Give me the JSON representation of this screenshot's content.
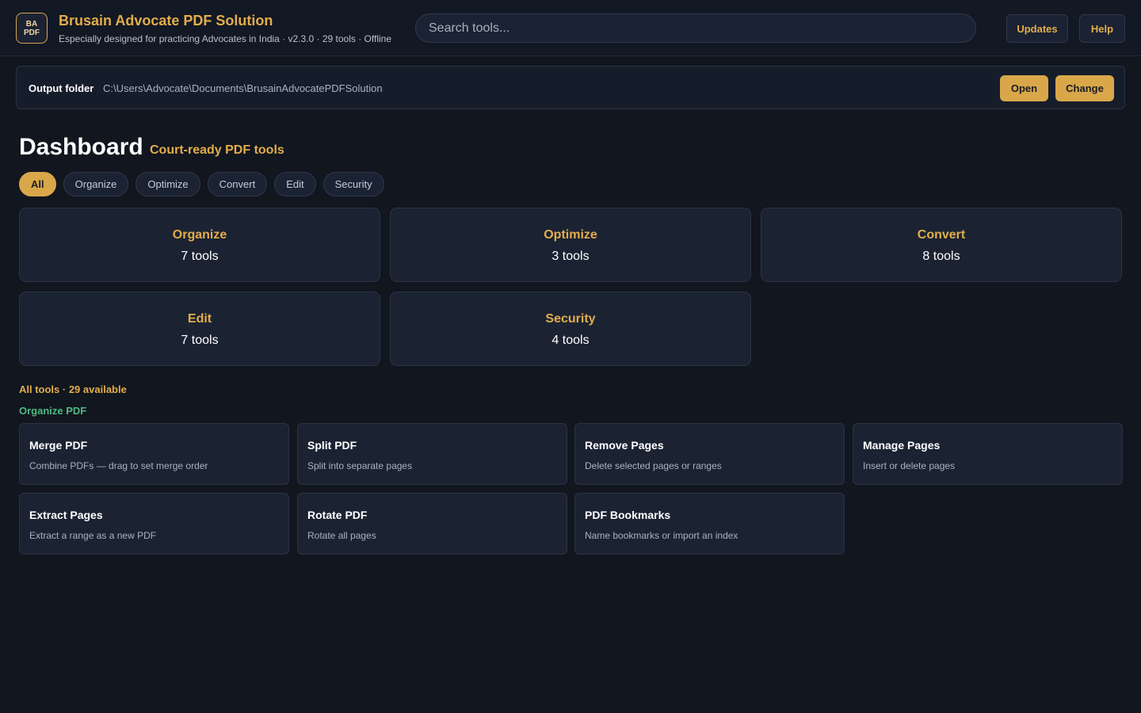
{
  "header": {
    "logo_line1": "BA",
    "logo_line2": "PDF",
    "title": "Brusain Advocate PDF Solution",
    "subtitle": "Especially designed for practicing Advocates in India · v2.3.0 · 29 tools · Offline",
    "search_placeholder": "Search tools...",
    "updates_label": "Updates",
    "help_label": "Help"
  },
  "output": {
    "label": "Output folder",
    "path": "C:\\Users\\Advocate\\Documents\\BrusainAdvocatePDFSolution",
    "open_label": "Open",
    "change_label": "Change"
  },
  "dashboard": {
    "title": "Dashboard",
    "subtitle": "Court-ready PDF tools",
    "filters": [
      "All",
      "Organize",
      "Optimize",
      "Convert",
      "Edit",
      "Security"
    ],
    "active_filter": "All"
  },
  "categories": [
    {
      "name": "Organize",
      "count": "7 tools"
    },
    {
      "name": "Optimize",
      "count": "3 tools"
    },
    {
      "name": "Convert",
      "count": "8 tools"
    },
    {
      "name": "Edit",
      "count": "7 tools"
    },
    {
      "name": "Security",
      "count": "4 tools"
    }
  ],
  "tools_summary": "All tools · 29 available",
  "organize_section": {
    "title": "Organize PDF",
    "tools": [
      {
        "name": "Merge PDF",
        "desc": "Combine PDFs — drag to set merge order"
      },
      {
        "name": "Split PDF",
        "desc": "Split into separate pages"
      },
      {
        "name": "Remove Pages",
        "desc": "Delete selected pages or ranges"
      },
      {
        "name": "Manage Pages",
        "desc": "Insert or delete pages"
      },
      {
        "name": "Extract Pages",
        "desc": "Extract a range as a new PDF"
      },
      {
        "name": "Rotate PDF",
        "desc": "Rotate all pages"
      },
      {
        "name": "PDF Bookmarks",
        "desc": "Name bookmarks or import an index"
      }
    ]
  },
  "colors": {
    "background": "#11161f",
    "accent": "#e3ad4a",
    "card": "#1b2333",
    "section_green": "#4fba83"
  }
}
